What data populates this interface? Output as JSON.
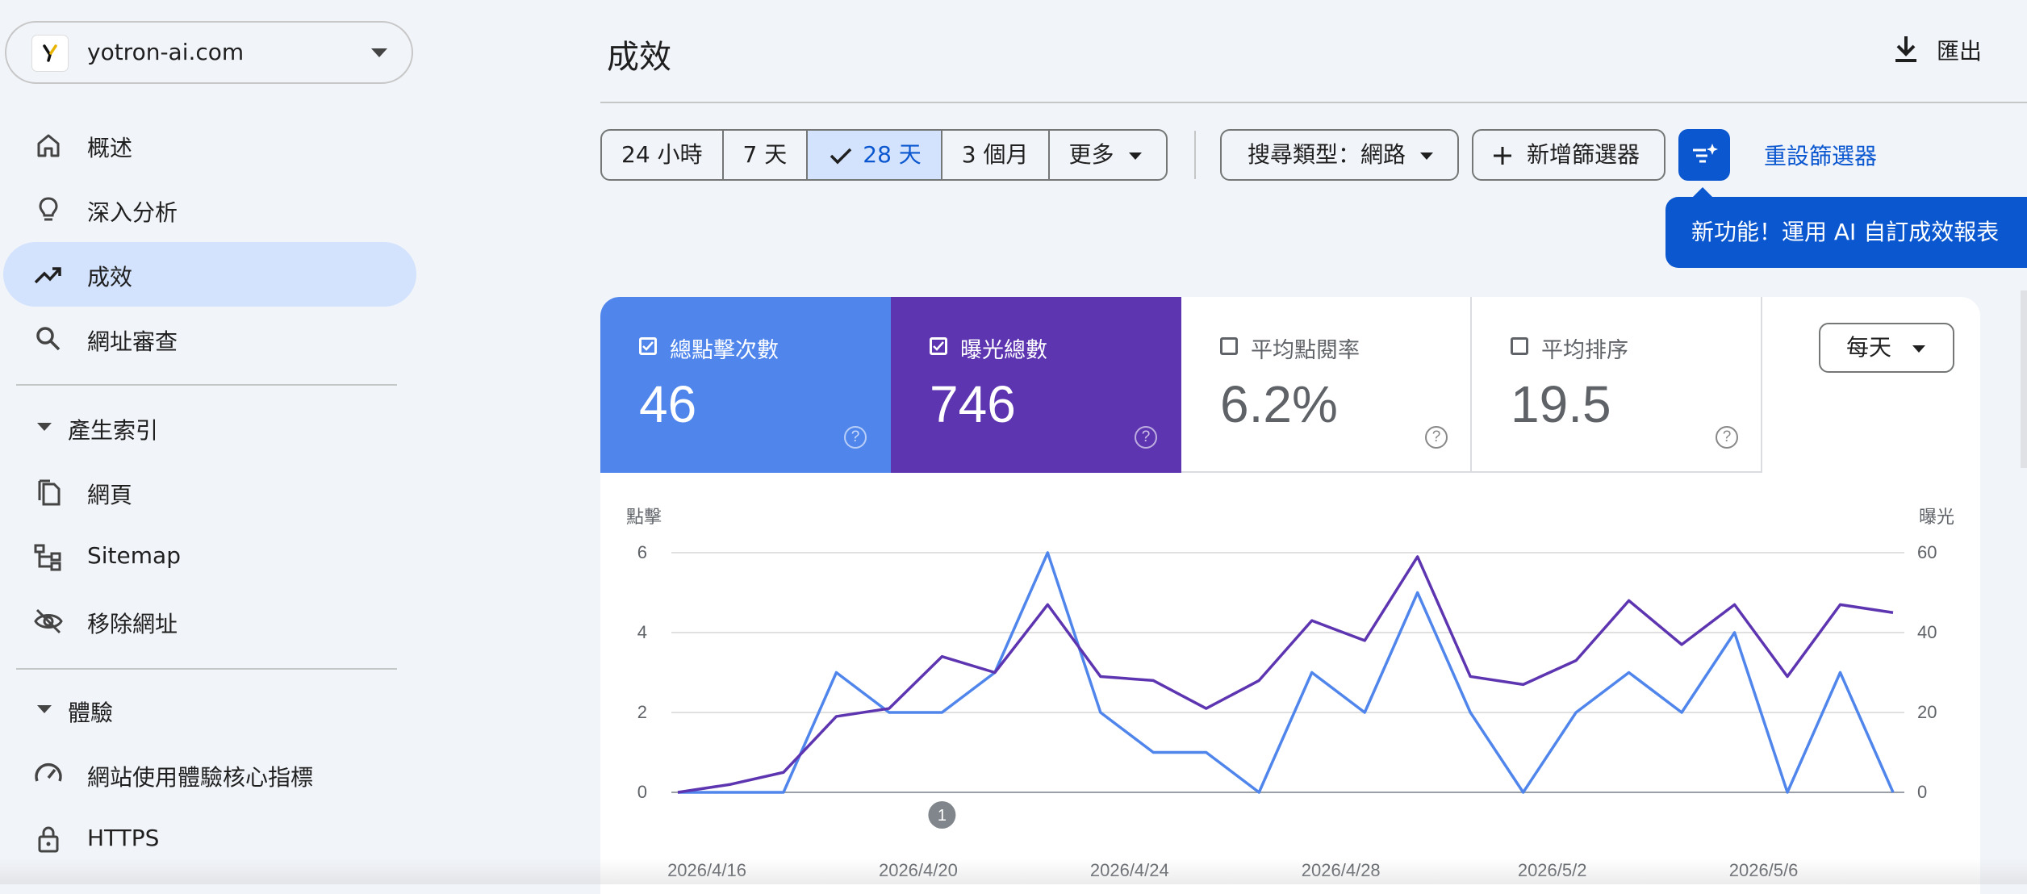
{
  "site": {
    "name": "yotron-ai.com",
    "logo_letter": "Y"
  },
  "sidebar": {
    "items": [
      {
        "key": "overview",
        "label": "概述",
        "icon": "home-icon"
      },
      {
        "key": "insights",
        "label": "深入分析",
        "icon": "lightbulb-icon"
      },
      {
        "key": "performance",
        "label": "成效",
        "icon": "trending-up-icon",
        "active": true
      },
      {
        "key": "url-inspection",
        "label": "網址審查",
        "icon": "search-icon"
      }
    ],
    "sections": [
      {
        "title": "產生索引",
        "items": [
          {
            "key": "pages",
            "label": "網頁",
            "icon": "pages-icon"
          },
          {
            "key": "sitemap",
            "label": "Sitemap",
            "icon": "sitemap-icon"
          },
          {
            "key": "removals",
            "label": "移除網址",
            "icon": "eye-off-icon"
          }
        ]
      },
      {
        "title": "體驗",
        "items": [
          {
            "key": "cwv",
            "label": "網站使用體驗核心指標",
            "icon": "speedometer-icon"
          },
          {
            "key": "https",
            "label": "HTTPS",
            "icon": "lock-icon"
          }
        ]
      }
    ]
  },
  "header": {
    "title": "成效",
    "export_label": "匯出"
  },
  "filters": {
    "date_ranges": [
      "24 小時",
      "7 天",
      "28 天",
      "3 個月"
    ],
    "selected_range": "28 天",
    "more_label": "更多",
    "search_type": "搜尋類型：網路",
    "add_filter": "新增篩選器",
    "reset": "重設篩選器",
    "ai_tooltip": "新功能！運用 AI 自訂成效報表"
  },
  "metrics": {
    "clicks": {
      "label": "總點擊次數",
      "value": "46",
      "checked": true,
      "color": "#5086ec"
    },
    "impressions": {
      "label": "曝光總數",
      "value": "746",
      "checked": true,
      "color": "#5e35b1"
    },
    "ctr": {
      "label": "平均點閱率",
      "value": "6.2%",
      "checked": false
    },
    "position": {
      "label": "平均排序",
      "value": "19.5",
      "checked": false
    }
  },
  "granularity": "每天",
  "chart_data": {
    "type": "line",
    "left_axis_label": "點擊",
    "right_axis_label": "曝光",
    "left_ticks": [
      "0",
      "2",
      "4",
      "6"
    ],
    "right_ticks": [
      "0",
      "20",
      "40",
      "60"
    ],
    "left_ylim": [
      0,
      6
    ],
    "right_ylim": [
      0,
      60
    ],
    "x_ticks": [
      "2026/4/16",
      "2026/4/20",
      "2026/4/24",
      "2026/4/28",
      "2026/5/2",
      "2026/5/6"
    ],
    "x": [
      "2026/4/16",
      "2026/4/17",
      "2026/4/18",
      "2026/4/19",
      "2026/4/20",
      "2026/4/21",
      "2026/4/22",
      "2026/4/23",
      "2026/4/24",
      "2026/4/25",
      "2026/4/26",
      "2026/4/27",
      "2026/4/28",
      "2026/4/29",
      "2026/4/30",
      "2026/5/1",
      "2026/5/2",
      "2026/5/3",
      "2026/5/4",
      "2026/5/5",
      "2026/5/6",
      "2026/5/7",
      "2026/5/8",
      "2026/5/9"
    ],
    "annotation": {
      "label": "1",
      "x": "2026/4/21"
    },
    "series": [
      {
        "name": "總點擊次數",
        "axis": "left",
        "color": "#5086ec",
        "values": [
          0,
          0,
          0,
          3,
          2,
          2,
          3,
          6,
          2,
          1,
          1,
          0,
          3,
          2,
          5,
          2,
          0,
          2,
          3,
          2,
          4,
          0,
          3,
          0
        ]
      },
      {
        "name": "曝光總數",
        "axis": "right",
        "color": "#5e35b1",
        "values": [
          0,
          2,
          5,
          19,
          21,
          34,
          30,
          47,
          29,
          28,
          21,
          28,
          43,
          38,
          59,
          29,
          27,
          33,
          48,
          37,
          47,
          29,
          47,
          45
        ]
      }
    ]
  }
}
